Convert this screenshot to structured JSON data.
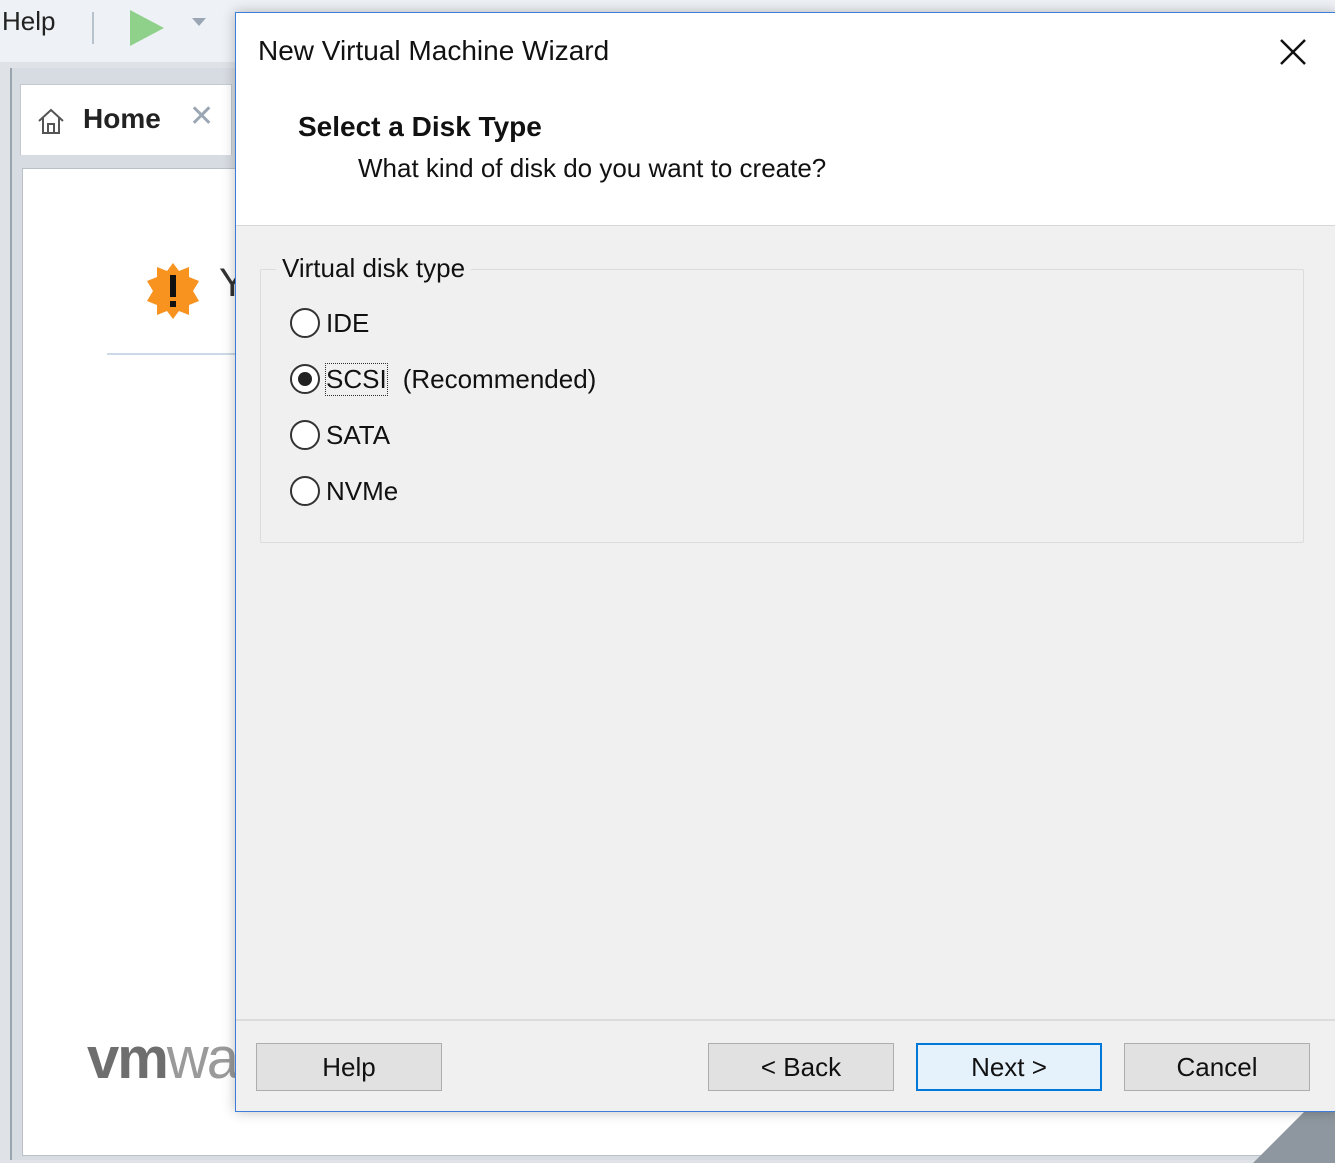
{
  "background": {
    "menu_help": "Help",
    "home_tab": {
      "label": "Home",
      "icon": "home-icon",
      "close_icon": "close-icon"
    },
    "warning_text": "Y",
    "logo": {
      "strong": "vm",
      "light": "wa"
    }
  },
  "dialog": {
    "title": "New Virtual Machine Wizard",
    "close_icon": "close-icon",
    "header": {
      "title": "Select a Disk Type",
      "subtitle": "What kind of disk do you want to create?"
    },
    "group": {
      "legend": "Virtual disk type",
      "options": [
        {
          "label": "IDE",
          "checked": false
        },
        {
          "label": "SCSI",
          "checked": true,
          "note": "(Recommended)"
        },
        {
          "label": "SATA",
          "checked": false
        },
        {
          "label": "NVMe",
          "checked": false
        }
      ]
    },
    "buttons": {
      "help": "Help",
      "back": "< Back",
      "next": "Next >",
      "cancel": "Cancel"
    }
  },
  "colors": {
    "accent": "#0078d7",
    "dialog_border": "#3b7dd8",
    "warning": "#f7931e"
  }
}
